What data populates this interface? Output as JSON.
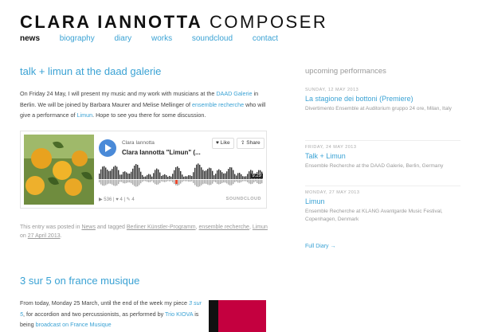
{
  "site": {
    "name": "CLARA IANNOTTA",
    "role": "COMPOSER"
  },
  "nav": [
    "news",
    "biography",
    "diary",
    "works",
    "soundcloud",
    "contact"
  ],
  "post1": {
    "title": "talk + limun at the daad galerie",
    "p1": "On Friday 24 May, I will present my music and my work with musicians at the ",
    "l1": "DAAD Galerie",
    "p2": " in Berlin. We will be joined by Barbara Maurer and Melise Mellinger of ",
    "l2": "ensemble recherche",
    "p3": " who will give a performance of ",
    "l3": "Limun",
    "p4": ". Hope to see you there for some discussion.",
    "player": {
      "user": "Clara Iannotta",
      "track": "Clara Iannotta \"Limun\" (...",
      "like": "Like",
      "share": "Share",
      "time": "9:29",
      "plays": "536",
      "likes": "4",
      "comments": "4",
      "logo": "SOUNDCLOUD"
    },
    "meta": {
      "a": "This entry was posted in ",
      "cat": "News",
      "b": " and tagged ",
      "t1": "Berliner Künstler-Programm",
      "c": ", ",
      "t2": "ensemble recherche",
      "d": ", ",
      "t3": "Limun",
      "e": " on ",
      "date": "27 April 2013",
      "f": "."
    }
  },
  "post2": {
    "title": "3 sur 5 on france musique",
    "p1": "From today, Monday 25 March, until the end of the week my piece ",
    "l1": "3 sur 5",
    "p2": ", for accordion and two percussionists, as performed by ",
    "l2": "Trio KIOVA",
    "p3": " is being ",
    "l3": "broadcast on France Musique"
  },
  "sidebar": {
    "heading": "upcoming performances",
    "performances": [
      {
        "date": "SUNDAY, 12 MAY 2013",
        "title": "La stagione dei bottoni (Premiere)",
        "desc": "Divertimento Ensemble at Auditorium gruppo 24 ore, Milan, Italy"
      },
      {
        "date": "FRIDAY, 24 MAY 2013",
        "title": "Talk + Limun",
        "desc": "Ensemble Recherche at the DAAD Galerie, Berlin, Germany"
      },
      {
        "date": "MONDAY, 27 MAY 2013",
        "title": "Limun",
        "desc": "Ensemble Recherche at KLANG Avantgarde Music Festival, Copenhagen, Denmark"
      }
    ],
    "full_diary": "Full Diary →"
  }
}
